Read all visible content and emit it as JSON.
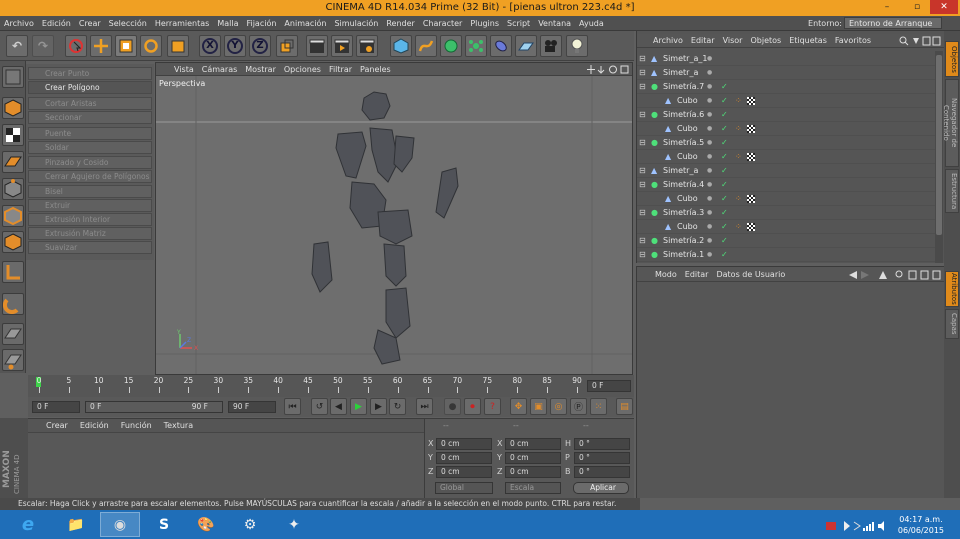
{
  "window": {
    "title": "CINEMA 4D R14.034 Prime (32 Bit) - [pienas ultron 223.c4d *]",
    "minimize": "–",
    "restore": "▫",
    "close": "✕"
  },
  "menubar": {
    "items": [
      "Archivo",
      "Edición",
      "Crear",
      "Selección",
      "Herramientas",
      "Malla",
      "Fijación",
      "Animación",
      "Simulación",
      "Render",
      "Character",
      "Plugins",
      "Script",
      "Ventana",
      "Ayuda"
    ],
    "env_label": "Entorno:",
    "env_value": "Entorno de Arranque"
  },
  "toolbar": {
    "undo": "↶",
    "redo": "↷",
    "x": "X",
    "y": "Y",
    "z": "Z"
  },
  "mesh_menu": {
    "items": [
      {
        "label": "Crear Punto",
        "active": false
      },
      {
        "label": "Crear Polígono",
        "active": true
      },
      {
        "label": "Cortar Aristas",
        "active": false
      },
      {
        "label": "Seccionar",
        "active": false
      },
      {
        "label": "Puente",
        "active": false
      },
      {
        "label": "Soldar",
        "active": false
      },
      {
        "label": "Pinzado y Cosido",
        "active": false
      },
      {
        "label": "Cerrar Agujero de Polígonos",
        "active": false
      },
      {
        "label": "Bisel",
        "active": false
      },
      {
        "label": "Extruir",
        "active": false
      },
      {
        "label": "Extrusión Interior",
        "active": false
      },
      {
        "label": "Extrusión Matriz",
        "active": false
      },
      {
        "label": "Suavizar",
        "active": false
      }
    ]
  },
  "viewport": {
    "menu": [
      "Vista",
      "Cámaras",
      "Mostrar",
      "Opciones",
      "Filtrar",
      "Paneles"
    ],
    "label": "Perspectiva",
    "axis_y": "Y",
    "axis_x": "X",
    "axis_z": "Z"
  },
  "timeline": {
    "ticks": [
      "0",
      "5",
      "10",
      "15",
      "20",
      "25",
      "30",
      "35",
      "40",
      "45",
      "50",
      "55",
      "60",
      "65",
      "70",
      "75",
      "80",
      "85",
      "90"
    ],
    "frame_field": "0 F"
  },
  "playbar": {
    "start": "0 F",
    "range_start": "0 F",
    "range_end": "90 F",
    "end": "90 F"
  },
  "materials": {
    "menu": [
      "Crear",
      "Edición",
      "Función",
      "Textura"
    ]
  },
  "coords": {
    "headers": [
      "--",
      "--",
      "--"
    ],
    "rows": [
      {
        "a": "X",
        "av": "0 cm",
        "b": "X",
        "bv": "0 cm",
        "c": "H",
        "cv": "0 °"
      },
      {
        "a": "Y",
        "av": "0 cm",
        "b": "Y",
        "bv": "0 cm",
        "c": "P",
        "cv": "0 °"
      },
      {
        "a": "Z",
        "av": "0 cm",
        "b": "Z",
        "bv": "0 cm",
        "c": "B",
        "cv": "0 °"
      }
    ],
    "mode": "Global",
    "scale": "Escala",
    "apply": "Aplicar"
  },
  "logo": {
    "line1": "MAXON",
    "line2": "CINEMA 4D"
  },
  "status": "Escalar: Haga Click y arrastre para escalar elementos. Pulse MAYÚSCULAS para cuantificar la escala / añadir a la selección en el modo punto. CTRL para restar.",
  "objects": {
    "menu": [
      "Archivo",
      "Editar",
      "Visor",
      "Objetos",
      "Etiquetas",
      "Favoritos"
    ],
    "rows": [
      {
        "name": "Simetr_a_1",
        "indent": 0,
        "type": "sym",
        "tags": false
      },
      {
        "name": "Simetr_a",
        "indent": 0,
        "type": "sym",
        "tags": false
      },
      {
        "name": "Simetría.7",
        "indent": 0,
        "type": "sym2",
        "tags": false
      },
      {
        "name": "Cubo",
        "indent": 1,
        "type": "poly",
        "tags": true
      },
      {
        "name": "Simetría.6",
        "indent": 0,
        "type": "sym2",
        "tags": false
      },
      {
        "name": "Cubo",
        "indent": 1,
        "type": "poly",
        "tags": true
      },
      {
        "name": "Simetría.5",
        "indent": 0,
        "type": "sym2",
        "tags": false
      },
      {
        "name": "Cubo",
        "indent": 1,
        "type": "poly",
        "tags": true
      },
      {
        "name": "Simetr_a",
        "indent": 0,
        "type": "sym",
        "tags": false
      },
      {
        "name": "Simetría.4",
        "indent": 0,
        "type": "sym2",
        "tags": false
      },
      {
        "name": "Cubo",
        "indent": 1,
        "type": "poly",
        "tags": true
      },
      {
        "name": "Simetría.3",
        "indent": 0,
        "type": "sym2",
        "tags": false
      },
      {
        "name": "Cubo",
        "indent": 1,
        "type": "poly",
        "tags": true
      },
      {
        "name": "Simetría.2",
        "indent": 0,
        "type": "sym2",
        "tags": false
      },
      {
        "name": "Simetría.1",
        "indent": 0,
        "type": "sym2",
        "tags": false
      }
    ]
  },
  "attributes": {
    "menu": [
      "Modo",
      "Editar",
      "Datos de Usuario"
    ]
  },
  "side_tabs": [
    {
      "label": "Objetos",
      "active": true
    },
    {
      "label": "Navegador de Contenido",
      "active": false
    },
    {
      "label": "Estructura",
      "active": false
    },
    {
      "label": "Atributos",
      "active": true
    },
    {
      "label": "Capas",
      "active": false
    }
  ],
  "taskbar": {
    "apps": [
      "e",
      "📁",
      "◉",
      "S",
      "🎨",
      "⚙",
      "✦"
    ],
    "time": "04:17 a.m.",
    "date": "06/06/2015"
  },
  "colors": {
    "accent": "#f0a023",
    "taskbar": "#1f6eb8",
    "viewport": "#6e6e6e"
  }
}
